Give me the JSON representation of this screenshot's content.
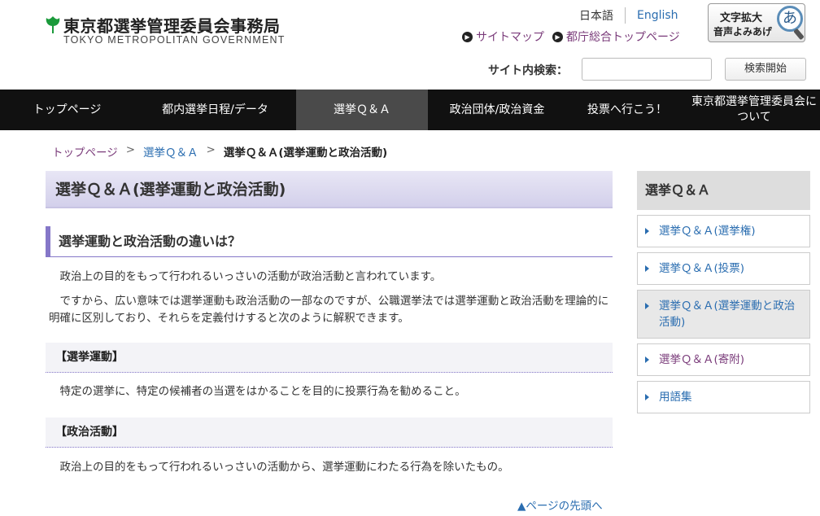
{
  "header": {
    "logo_jp": "東京都選挙管理委員会事務局",
    "logo_en": "TOKYO METROPOLITAN GOVERNMENT",
    "lang_ja": "日本語",
    "lang_en": "English",
    "sitemap": "サイトマップ",
    "govtop": "都庁総合トップページ",
    "a11y_line1": "文字拡大",
    "a11y_line2": "音声よみあげ",
    "a11y_glyph": "あ",
    "search_label": "サイト内検索：",
    "search_button": "検索開始",
    "search_value": ""
  },
  "nav": [
    {
      "label": "トップページ"
    },
    {
      "label": "都内選挙日程/データ"
    },
    {
      "label": "選挙Ｑ＆Ａ"
    },
    {
      "label": "政治団体/政治資金"
    },
    {
      "label": "投票へ行こう！"
    },
    {
      "label": "東京都選挙管理委員会について"
    }
  ],
  "breadcrumb": {
    "home": "トップページ",
    "qa": "選挙Ｑ＆Ａ",
    "current": "選挙Ｑ＆Ａ(選挙運動と政治活動)"
  },
  "main": {
    "title": "選挙Ｑ＆Ａ(選挙運動と政治活動)",
    "section_heading": "選挙運動と政治活動の違いは？",
    "para1": "　政治上の目的をもって行われるいっさいの活動が政治活動と言われています。",
    "para2": "　ですから、広い意味では選挙運動も政治活動の一部なのですが、公職選挙法では選挙運動と政治活動を理論的に明確に区別しており、それらを定義付けすると次のように解釈できます。",
    "sub1": "【選挙運動】",
    "para3": "　特定の選挙に、特定の候補者の当選をはかることを目的に投票行為を勧めること。",
    "sub2": "【政治活動】",
    "para4": "　政治上の目的をもって行われるいっさいの活動から、選挙運動にわたる行為を除いたもの。",
    "pagetop": "▲ページの先頭へ"
  },
  "sidebar": {
    "heading": "選挙Ｑ＆Ａ",
    "items": [
      {
        "label": "選挙Ｑ＆Ａ(選挙権)"
      },
      {
        "label": "選挙Ｑ＆Ａ(投票)"
      },
      {
        "label": "選挙Ｑ＆Ａ(選挙運動と政治活動)"
      },
      {
        "label": "選挙Ｑ＆Ａ(寄附)"
      },
      {
        "label": "用語集"
      }
    ]
  },
  "colors": {
    "nav_bg": "#111111",
    "accent_purple": "#8577c8",
    "link_blue": "#2a6db0",
    "visited_purple": "#7a3b7a"
  }
}
